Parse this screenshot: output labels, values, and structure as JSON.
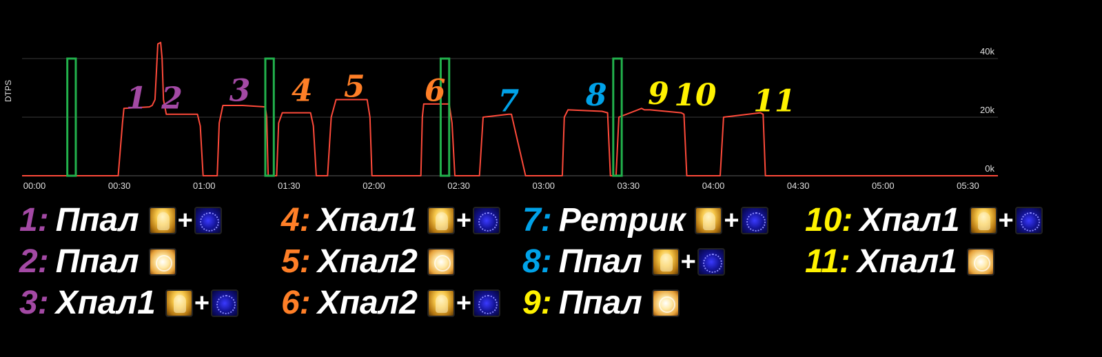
{
  "colors": {
    "background": "#000000",
    "line": "#ff4a3a",
    "grid": "#3a3a3a",
    "marker": "#22b14c",
    "purple": "#a349a4",
    "orange": "#ff7f27",
    "blue": "#00a2e8",
    "yellow": "#fff200"
  },
  "chart_data": {
    "type": "line",
    "ylabel": "DTPS",
    "ylim": [
      0,
      40000
    ],
    "xlim": [
      0,
      345
    ],
    "y_ticks": [
      {
        "value": 0,
        "label": "0k"
      },
      {
        "value": 20000,
        "label": "20k"
      },
      {
        "value": 40000,
        "label": "40k"
      }
    ],
    "x_ticks": [
      {
        "value": 0,
        "label": "00:00"
      },
      {
        "value": 30,
        "label": "00:30"
      },
      {
        "value": 60,
        "label": "01:00"
      },
      {
        "value": 90,
        "label": "01:30"
      },
      {
        "value": 120,
        "label": "02:00"
      },
      {
        "value": 150,
        "label": "02:30"
      },
      {
        "value": 180,
        "label": "03:00"
      },
      {
        "value": 210,
        "label": "03:30"
      },
      {
        "value": 240,
        "label": "04:00"
      },
      {
        "value": 270,
        "label": "04:30"
      },
      {
        "value": 300,
        "label": "05:00"
      },
      {
        "value": 330,
        "label": "05:30"
      }
    ],
    "grid": true,
    "series": [
      {
        "x": [
          0,
          17,
          34,
          35.5,
          36,
          45,
          46,
          47,
          48,
          49,
          49.5,
          50,
          51,
          62,
          63,
          64,
          64.5,
          66,
          69,
          69.7,
          71,
          78,
          86,
          86.5,
          87,
          87.5,
          88,
          89,
          90,
          90.7,
          92,
          102,
          103,
          104,
          104.7,
          106,
          108,
          109.3,
          111,
          122,
          123,
          123.7,
          125,
          140,
          141,
          141.5,
          142,
          151,
          152,
          153,
          154,
          160,
          161,
          161.7,
          163,
          172,
          173,
          178,
          179,
          180,
          190,
          191,
          191.7,
          193,
          205,
          207,
          208,
          208.7,
          210,
          211,
          219,
          220,
          222,
          233,
          234,
          235,
          245,
          246,
          246.8,
          248,
          261,
          262,
          262.8,
          264,
          274,
          275,
          276,
          345
        ],
        "y": [
          0,
          0,
          0,
          18000,
          23000,
          23500,
          24000,
          26000,
          45000,
          45500,
          40000,
          26000,
          21000,
          21000,
          17000,
          0,
          0,
          0,
          0,
          18000,
          24000,
          24000,
          23500,
          20000,
          0,
          0,
          0,
          0,
          0,
          18000,
          21500,
          21500,
          17000,
          0,
          0,
          0,
          0,
          20000,
          26000,
          26000,
          20000,
          0,
          0,
          0,
          0,
          20000,
          24500,
          24500,
          18000,
          0,
          0,
          0,
          0,
          0,
          20000,
          21000,
          21000,
          0,
          0,
          0,
          0,
          0,
          20000,
          22500,
          22000,
          21500,
          0,
          0,
          0,
          20000,
          23000,
          22500,
          22500,
          21500,
          21000,
          0,
          0,
          0,
          0,
          20000,
          21500,
          21000,
          0,
          0,
          0,
          0,
          0,
          0
        ]
      }
    ],
    "markers": [
      {
        "x_start": 16,
        "x_end": 19,
        "y_top": 40000
      },
      {
        "x_start": 86,
        "x_end": 89,
        "y_top": 40000
      },
      {
        "x_start": 148,
        "x_end": 151,
        "y_top": 40000
      },
      {
        "x_start": 209,
        "x_end": 212,
        "y_top": 40000
      }
    ],
    "annotations": [
      {
        "text": "1",
        "x": 40.5,
        "y": 23000,
        "color": "purple"
      },
      {
        "text": "2",
        "x": 53,
        "y": 23000,
        "color": "purple"
      },
      {
        "text": "3",
        "x": 77,
        "y": 25500,
        "color": "purple"
      },
      {
        "text": "4",
        "x": 99,
        "y": 25500,
        "color": "orange"
      },
      {
        "text": "5",
        "x": 117.5,
        "y": 27000,
        "color": "orange"
      },
      {
        "text": "6",
        "x": 146,
        "y": 25500,
        "color": "orange"
      },
      {
        "text": "7",
        "x": 172,
        "y": 22000,
        "color": "blue"
      },
      {
        "text": "8",
        "x": 203,
        "y": 24000,
        "color": "blue"
      },
      {
        "text": "9",
        "x": 225,
        "y": 24500,
        "color": "yellow"
      },
      {
        "text": "10",
        "x": 238,
        "y": 24000,
        "color": "yellow"
      },
      {
        "text": "11",
        "x": 266,
        "y": 22000,
        "color": "yellow"
      }
    ]
  },
  "legend": [
    {
      "num": "1:",
      "name": "Ппал",
      "color": "purple",
      "icons": [
        "paladin-icon",
        "plus",
        "rune-icon"
      ]
    },
    {
      "num": "2:",
      "name": "Ппал",
      "color": "purple",
      "icons": [
        "holy-light-icon"
      ]
    },
    {
      "num": "3:",
      "name": "Хпал1",
      "color": "purple",
      "icons": [
        "paladin-icon",
        "plus",
        "rune-icon"
      ]
    },
    {
      "num": "4:",
      "name": "Хпал1",
      "color": "orange",
      "icons": [
        "paladin-icon",
        "plus",
        "rune-icon"
      ]
    },
    {
      "num": "5:",
      "name": "Хпал2",
      "color": "orange",
      "icons": [
        "holy-light-icon"
      ]
    },
    {
      "num": "6:",
      "name": "Хпал2",
      "color": "orange",
      "icons": [
        "paladin-icon",
        "plus",
        "rune-icon"
      ]
    },
    {
      "num": "7:",
      "name": "Ретрик",
      "color": "blue",
      "icons": [
        "paladin-icon",
        "plus",
        "rune-icon"
      ]
    },
    {
      "num": "8:",
      "name": "Ппал",
      "color": "blue",
      "icons": [
        "paladin-icon",
        "plus",
        "rune-icon"
      ]
    },
    {
      "num": "9:",
      "name": "Ппал",
      "color": "yellow",
      "icons": [
        "holy-light-icon"
      ]
    },
    {
      "num": "10:",
      "name": "Хпал1",
      "color": "yellow",
      "icons": [
        "paladin-icon",
        "plus",
        "rune-icon"
      ]
    },
    {
      "num": "11:",
      "name": "Хпал1",
      "color": "yellow",
      "icons": [
        "holy-light-icon"
      ]
    }
  ],
  "plus_sign": "+"
}
